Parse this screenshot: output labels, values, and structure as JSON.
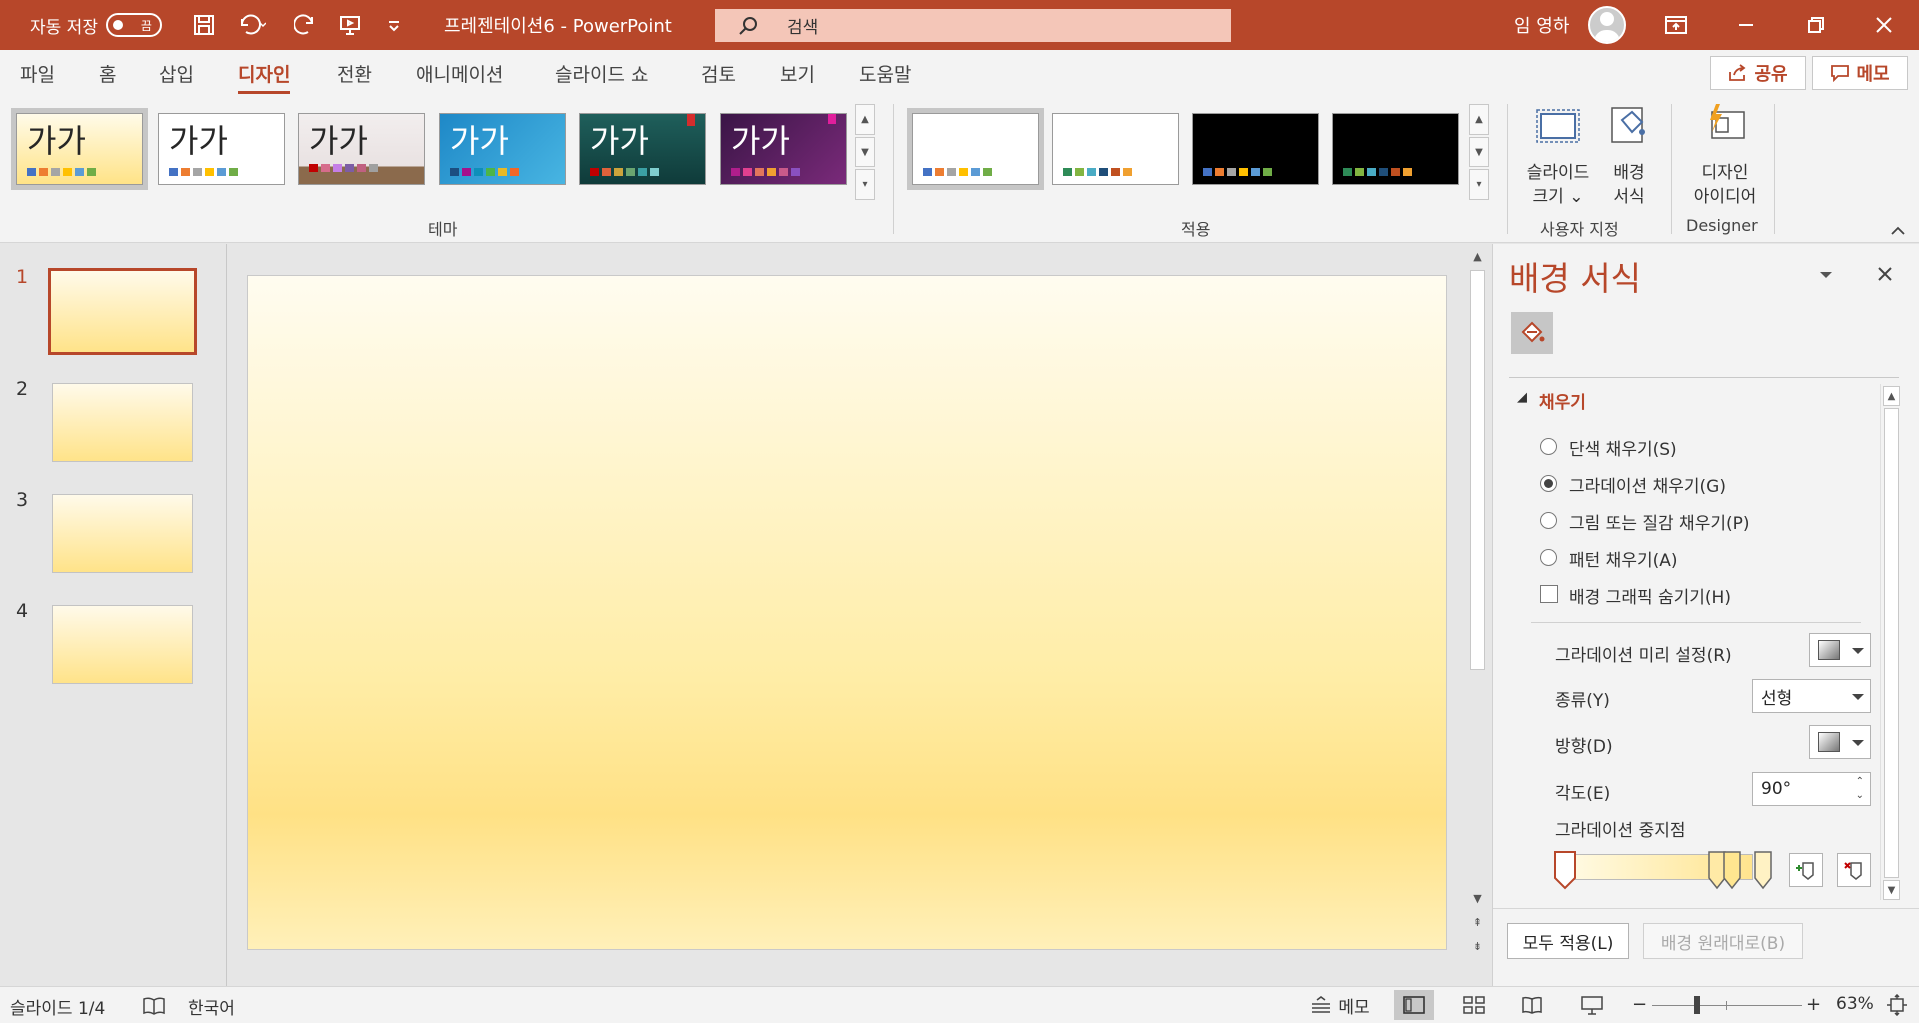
{
  "titlebar": {
    "autosave_label": "자동 저장",
    "autosave_state": "끔",
    "doc_title": "프레젠테이션6 - PowerPoint",
    "search_placeholder": "검색",
    "user_name": "임 영하",
    "accent": "#b7472a"
  },
  "ribbon_tabs": [
    "파일",
    "홈",
    "삽입",
    "디자인",
    "전환",
    "애니메이션",
    "슬라이드 쇼",
    "검토",
    "보기",
    "도움말"
  ],
  "active_tab": "디자인",
  "share_label": "공유",
  "comments_label": "메모",
  "theme_group": {
    "label": "테마",
    "thumb_text": "가가"
  },
  "variants_group": {
    "label": "적용"
  },
  "customize_group": {
    "label": "사용자 지정",
    "slide_size": "슬라이드 크기",
    "slide_size_line1": "슬라이드",
    "slide_size_line2": "크기",
    "format_bg_line1": "배경",
    "format_bg_line2": "서식"
  },
  "designer_group": {
    "label": "Designer",
    "line1": "디자인",
    "line2": "아이디어"
  },
  "slides": [
    {
      "num": "1",
      "active": true
    },
    {
      "num": "2",
      "active": false
    },
    {
      "num": "3",
      "active": false
    },
    {
      "num": "4",
      "active": false
    }
  ],
  "format_pane": {
    "title": "배경 서식",
    "section_fill": "채우기",
    "options": {
      "solid": "단색 채우기(S)",
      "gradient": "그라데이션 채우기(G)",
      "picture": "그림 또는 질감 채우기(P)",
      "pattern": "패턴 채우기(A)"
    },
    "selected_option": "gradient",
    "hide_bg_graphics": "배경 그래픽 숨기기(H)",
    "preset_label": "그라데이션 미리 설정(R)",
    "type_label": "종류(Y)",
    "type_value": "선형",
    "direction_label": "방향(D)",
    "angle_label": "각도(E)",
    "angle_value": "90°",
    "stops_label": "그라데이션 중지점",
    "apply_all": "모두 적용(L)",
    "reset_bg": "배경 원래대로(B)"
  },
  "statusbar": {
    "slide_info": "슬라이드 1/4",
    "language": "한국어",
    "notes": "메모",
    "zoom": "63%"
  }
}
